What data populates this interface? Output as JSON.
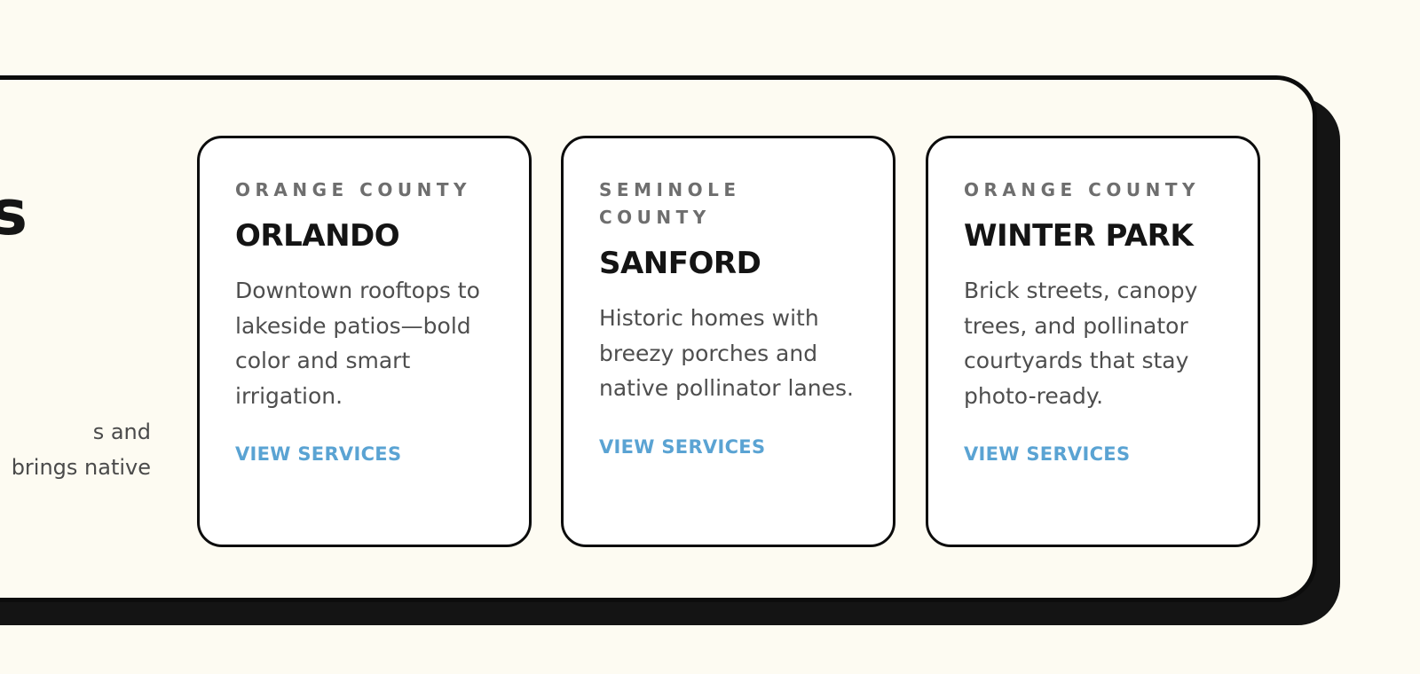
{
  "intro": {
    "heading_fragment": "s",
    "text_lines": [
      "s and",
      "brings native"
    ]
  },
  "colors": {
    "background": "#fdfbf2",
    "border": "#0c0c0c",
    "link": "#5aa3d3"
  },
  "cards": [
    {
      "county": "ORANGE COUNTY",
      "title": "ORLANDO",
      "description": "Downtown rooftops to lakeside patios—bold color and smart irrigation.",
      "link_label": "VIEW SERVICES"
    },
    {
      "county": "SEMINOLE COUNTY",
      "title": "SANFORD",
      "description": "Historic homes with breezy porches and native pollinator lanes.",
      "link_label": "VIEW SERVICES"
    },
    {
      "county": "ORANGE COUNTY",
      "title": "WINTER PARK",
      "description": "Brick streets, canopy trees, and pollinator courtyards that stay photo-ready.",
      "link_label": "VIEW SERVICES"
    }
  ]
}
